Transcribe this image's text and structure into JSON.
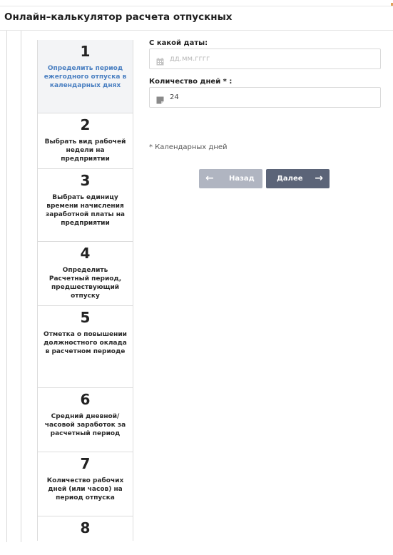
{
  "page": {
    "title": "Онлайн–калькулятор расчета отпускных"
  },
  "steps": [
    {
      "number": "1",
      "label": "Определить период ежегодного отпуска в календарных днях",
      "active": true
    },
    {
      "number": "2",
      "label": "Выбрать вид рабочей недели на предприятии"
    },
    {
      "number": "3",
      "label": "Выбрать единицу времени начисления заработной платы на предприятии"
    },
    {
      "number": "4",
      "label": "Определить Расчетный период, предшествующий отпуску"
    },
    {
      "number": "5",
      "label": "Отметка о повышении должностного оклада в расчетном периоде"
    },
    {
      "number": "6",
      "label": "Средний дневной/ часовой заработок за расчетный период"
    },
    {
      "number": "7",
      "label": "Количество рабочих дней (или часов) на период отпуска"
    },
    {
      "number": "8",
      "label": ""
    }
  ],
  "form": {
    "start_date": {
      "label": "С какой даты:",
      "placeholder": "дд.мм.гггг",
      "value": "",
      "icon": "calendar-icon"
    },
    "days": {
      "label": "Количество дней * :",
      "value": "24",
      "icon": "note-icon"
    },
    "note": "* Календарных дней"
  },
  "buttons": {
    "back": {
      "label": "Назад",
      "icon": "arrow-left-icon",
      "color": "#b0b5c1"
    },
    "next": {
      "label": "Далее",
      "icon": "arrow-right-icon",
      "color": "#5b6478"
    }
  },
  "colors": {
    "active_step_text": "#4a7fc1",
    "active_step_bg": "#f3f4f6"
  }
}
